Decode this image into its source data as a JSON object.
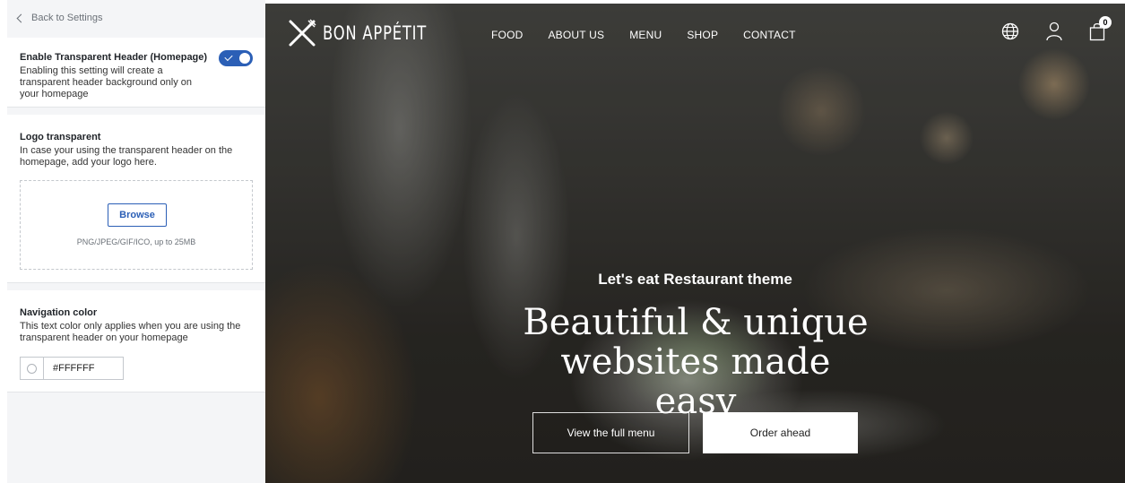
{
  "settings": {
    "back_label": "Back to Settings",
    "transparent_header": {
      "title": "Enable Transparent Header (Homepage)",
      "description": "Enabling this setting will create a transparent header background only on your homepage",
      "enabled": true
    },
    "logo": {
      "title": "Logo transparent",
      "description": "In case your using the transparent header on the homepage, add your logo here.",
      "browse_label": "Browse",
      "hint": "PNG/JPEG/GIF/ICO, up to 25MB"
    },
    "nav_color": {
      "title": "Navigation color",
      "description": "This text color only applies when you are using the transparent header on your homepage",
      "value": "#FFFFFF"
    }
  },
  "preview": {
    "brand": "BON APPÉTIT",
    "nav": [
      "FOOD",
      "ABOUT US",
      "MENU",
      "SHOP",
      "CONTACT"
    ],
    "cart_count": "0",
    "icons": [
      "globe-icon",
      "user-icon",
      "shopping-bag-icon"
    ],
    "eyebrow": "Let's eat Restaurant theme",
    "headline": "Beautiful & unique websites made easy",
    "primary_button": "View the full menu",
    "secondary_button": "Order ahead"
  },
  "colors": {
    "accent": "#2b5fb6",
    "nav_text": "#FFFFFF"
  }
}
